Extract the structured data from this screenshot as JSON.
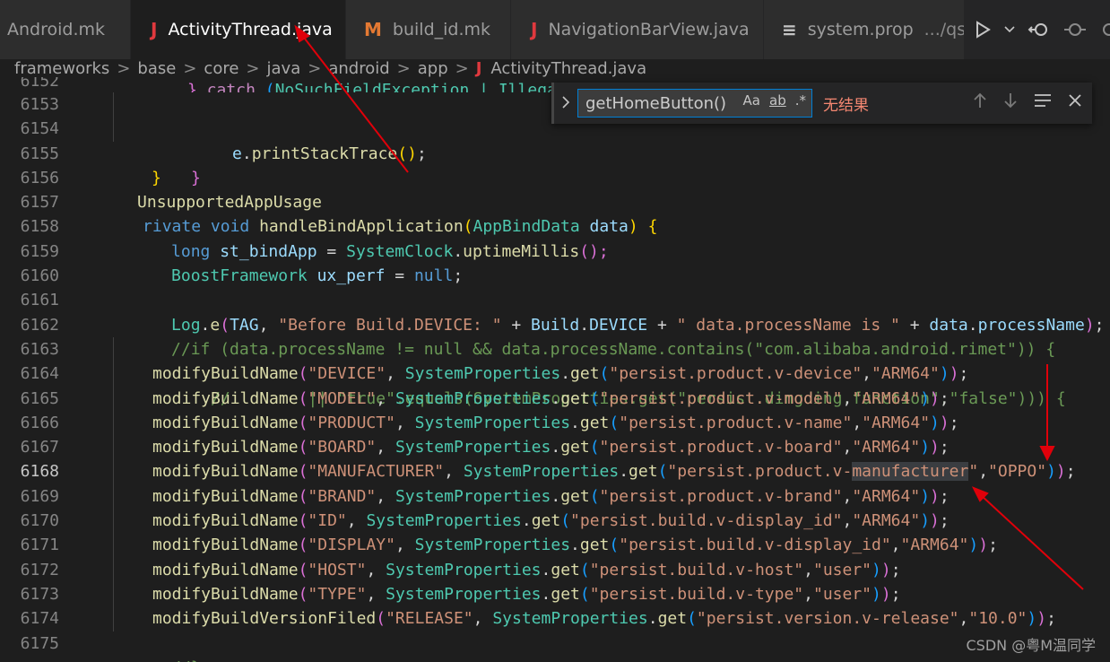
{
  "tabs": [
    {
      "label": "Android.mk",
      "icon": "",
      "active": false
    },
    {
      "label": "ActivityThread.java",
      "icon": "J",
      "active": true,
      "close": "✕"
    },
    {
      "label": "build_id.mk",
      "icon": "M",
      "active": false
    },
    {
      "label": "NavigationBarView.java",
      "icon": "J",
      "active": false
    },
    {
      "label": "system.prop",
      "icon": "≡",
      "desc": ".../qssi",
      "active": false
    }
  ],
  "breadcrumb": {
    "items": [
      "frameworks",
      "base",
      "core",
      "java",
      "android",
      "app"
    ],
    "separator": ">",
    "file_icon": "J",
    "file": "ActivityThread.java"
  },
  "find": {
    "value": "getHomeButton()",
    "opt_case": "Aa",
    "opt_word": "ab",
    "opt_regex": ".*",
    "result": "无结果"
  },
  "lines": [
    "6152",
    "6153",
    "6154",
    "6155",
    "6156",
    "6157",
    "6158",
    "6159",
    "6160",
    "6161",
    "6162",
    "6163",
    "6164",
    "6165",
    "6166",
    "6167",
    "6168",
    "6169",
    "6170",
    "6171",
    "6172",
    "6173",
    "6174",
    "6175"
  ],
  "code": {
    "l6152_a": "} ",
    "l6152_b": "catch ",
    "l6152_c": "(",
    "l6152_d": "NoSuchFieldException | IllegalAcc",
    "l6153_a": "e",
    "l6153_b": ".",
    "l6153_c": "printStackTrace",
    "l6153_d": "()",
    "l6154": "}",
    "l6155": "}",
    "l6156": "UnsupportedAppUsage",
    "l6157_a": "rivate ",
    "l6157_b": "void ",
    "l6157_c": "handleBindApplication",
    "l6157_d": "(",
    "l6157_e": "AppBindData ",
    "l6157_f": "data",
    "l6157_g": ") {",
    "l6158_a": "long ",
    "l6158_b": "st_bindApp",
    " l6158_c": " = ",
    "l6158_d": "SystemClock",
    "l6158_e": "uptimeMillis",
    "l6158_f": "();",
    "l6159_a": "BoostFramework ",
    "l6159_b": "ux_perf",
    "l6159_c": "null",
    "l6161_a": "Log",
    "l6161_b": "e",
    "l6161_c": "TAG",
    "l6161_d": "\"Before Build.DEVICE: \"",
    "l6161_e": "Build",
    "l6161_f": "DEVICE",
    "l6161_g": "\" data.processName is \"",
    "l6161_h": "data",
    "l6161_i": "processName",
    "l6162": "//if (data.processName != null && data.processName.contains(\"com.alibaba.android.rimet\")) {",
    "l6163": "//        || \"true\".equals(SystemProperties.get(\"persist.dingding.function\",\"false\"))) {",
    "l6175": "//}",
    "modify": "modifyBuildName",
    "modify_ver": "modifyBuildVersionFiled",
    "sp": "SystemProperties",
    "get": "get",
    "calls": [
      {
        "k": "\"DEVICE\"",
        "p": "\"persist.product.v-device\"",
        "d": "\"ARM64\""
      },
      {
        "k": "\"MODEL\"",
        "p": "\"persist.product.v-model\"",
        "d": "\"ARM64\""
      },
      {
        "k": "\"PRODUCT\"",
        "p": "\"persist.product.v-name\"",
        "d": "\"ARM64\""
      },
      {
        "k": "\"BOARD\"",
        "p": "\"persist.product.v-board\"",
        "d": "\"ARM64\""
      },
      {
        "k": "\"MANUFACTURER\"",
        "p1": "\"persist.product.v-",
        "p2": "manufacturer",
        "p3": "\"",
        "d": "\"OPPO\""
      },
      {
        "k": "\"BRAND\"",
        "p": "\"persist.product.v-brand\"",
        "d": "\"ARM64\""
      },
      {
        "k": "\"ID\"",
        "p": "\"persist.build.v-display_id\"",
        "d": "\"ARM64\""
      },
      {
        "k": "\"DISPLAY\"",
        "p": "\"persist.build.v-display_id\"",
        "d": "\"ARM64\""
      },
      {
        "k": "\"HOST\"",
        "p": "\"persist.build.v-host\"",
        "d": "\"user\""
      },
      {
        "k": "\"TYPE\"",
        "p": "\"persist.build.v-type\"",
        "d": "\"user\""
      },
      {
        "k": "\"RELEASE\"",
        "p": "\"persist.version.v-release\"",
        "d": "\"10.0\""
      }
    ]
  },
  "watermark": "CSDN @粤M温同学",
  "colors": {
    "arrow": "#e0000a",
    "background": "#1e1e1e",
    "find_no_result": "#f48771"
  }
}
